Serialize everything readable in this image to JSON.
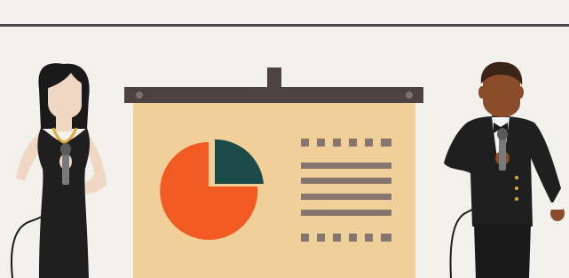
{
  "scene": {
    "description_icons": [
      "female-presenter-icon",
      "male-presenter-icon",
      "projector-screen-icon",
      "pie-chart-icon",
      "text-lines-icon"
    ]
  },
  "colors": {
    "background": "#f2f1eb",
    "top_rule": "#4a4750",
    "screen_bar": "#4c4340",
    "screen_board": "#f0cf98",
    "pie_orange": "#f15a22",
    "pie_teal": "#1c4a46",
    "text_lines": "#857670",
    "suit": "#1f1f1f",
    "skin_light": "#f0d7c4",
    "skin_dark": "#8a4c2a",
    "hair_dark": "#1a1a1a",
    "gold": "#e0a83a"
  },
  "pie": {
    "large_slice_fraction": 0.75,
    "small_slice_fraction": 0.25
  }
}
